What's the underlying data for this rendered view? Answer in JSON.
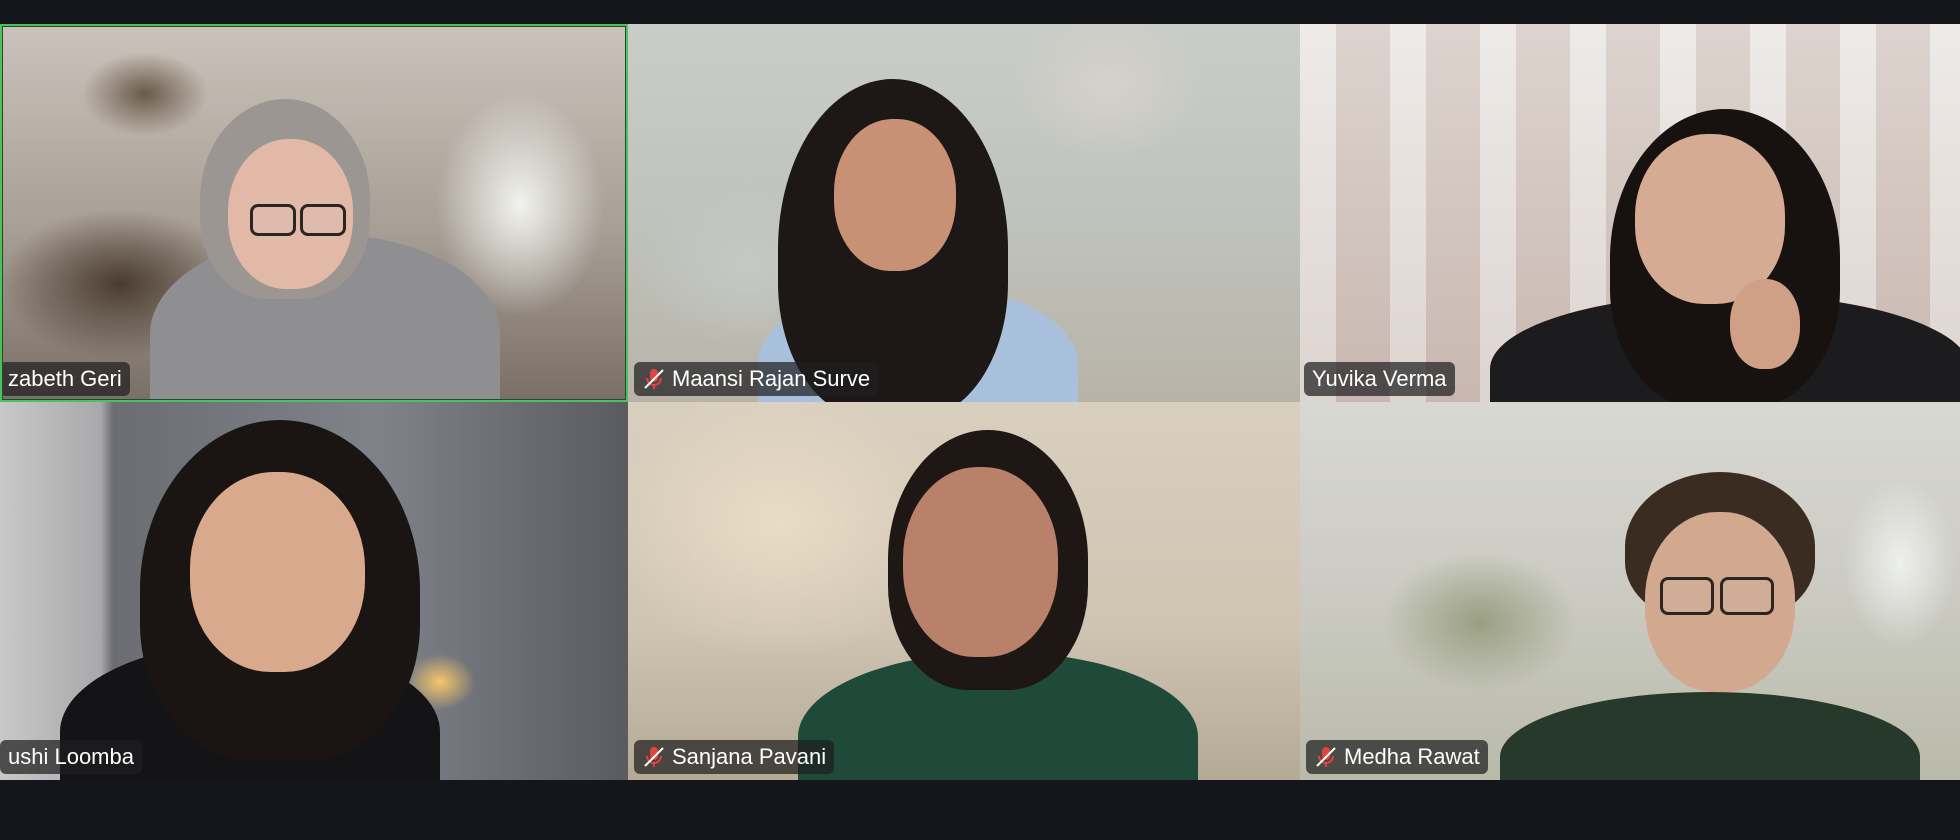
{
  "meeting": {
    "participants": [
      {
        "name": "zabeth Geri",
        "muted": false,
        "active_speaker": true
      },
      {
        "name": "Maansi Rajan Surve",
        "muted": true,
        "active_speaker": false
      },
      {
        "name": "Yuvika Verma",
        "muted": false,
        "active_speaker": false
      },
      {
        "name": "ushi Loomba",
        "muted": false,
        "active_speaker": false
      },
      {
        "name": "Sanjana Pavani",
        "muted": true,
        "active_speaker": false
      },
      {
        "name": "Medha Rawat",
        "muted": true,
        "active_speaker": false
      }
    ],
    "colors": {
      "active_speaker_border": "#4fbf5f",
      "muted_icon": "#e0443e",
      "background": "#14161b",
      "label_bg": "rgba(30,30,32,0.72)"
    },
    "icons": {
      "muted": "mic-off-icon"
    }
  }
}
